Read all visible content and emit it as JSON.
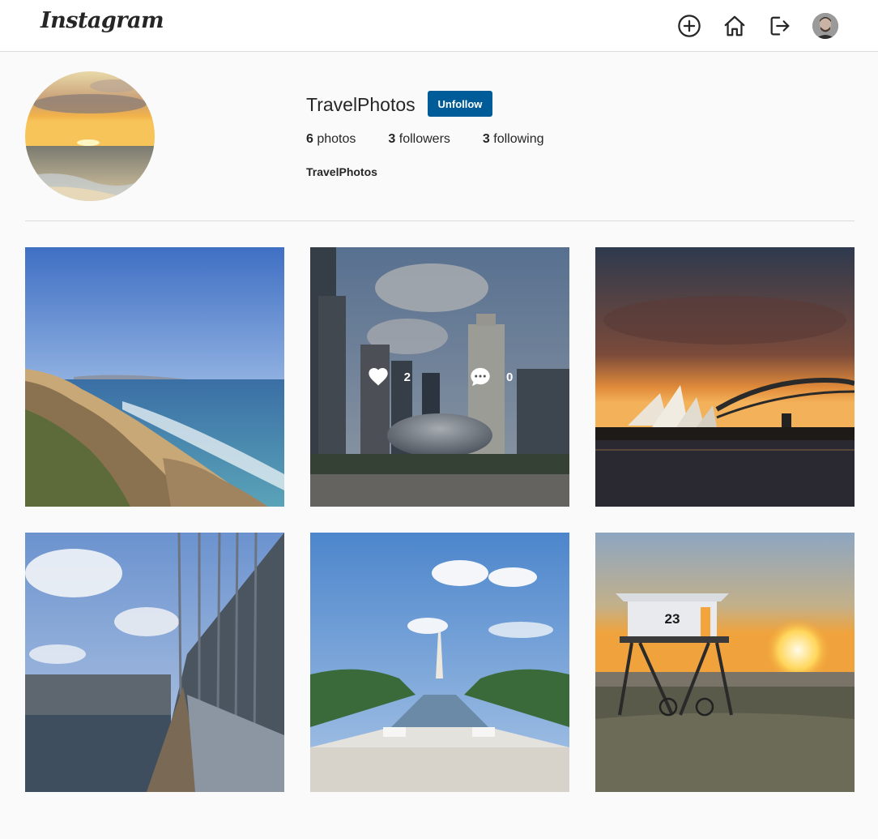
{
  "header": {
    "logo": "Instagram",
    "icons": [
      "add-post-icon",
      "home-icon",
      "logout-icon",
      "user-avatar"
    ]
  },
  "profile": {
    "username": "TravelPhotos",
    "follow_button": "Unfollow",
    "stats": {
      "photos_count": "6",
      "photos_label": "photos",
      "followers_count": "3",
      "followers_label": "followers",
      "following_count": "3",
      "following_label": "following"
    },
    "full_name": "TravelPhotos"
  },
  "posts": [
    {
      "subject": "coastline cliffs"
    },
    {
      "subject": "city bean sculpture",
      "likes": "2",
      "comments": "0"
    },
    {
      "subject": "opera house at sunset"
    },
    {
      "subject": "suspension bridge"
    },
    {
      "subject": "monument reflecting pool"
    },
    {
      "subject": "lifeguard tower at sunset",
      "tower_number": "23"
    }
  ],
  "colors": {
    "accent": "#005c98",
    "border": "#dbdbdb",
    "background": "#fafafa"
  }
}
